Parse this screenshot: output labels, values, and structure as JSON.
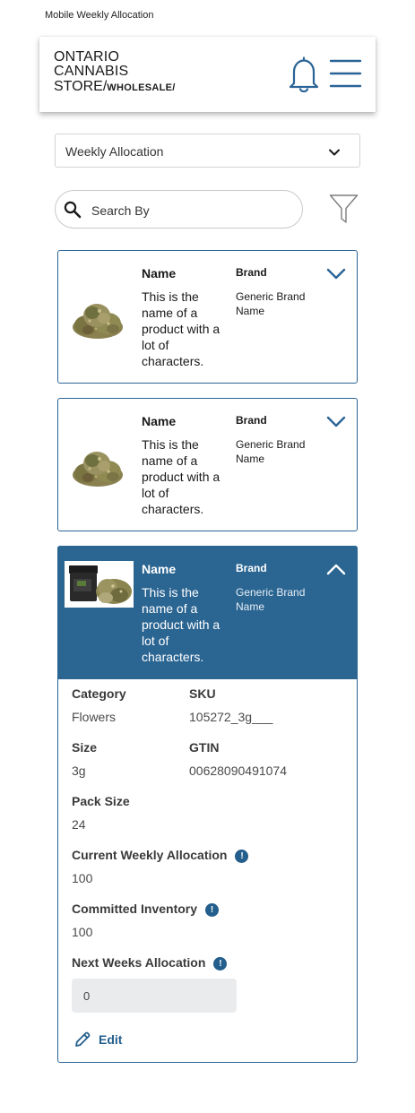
{
  "frame_label": "Mobile Weekly Allocation",
  "header": {
    "logo": {
      "line1": "ONTARIO",
      "line2": "CANNABIS",
      "line3": "STORE",
      "slash": "/",
      "sub": "WHOLESALE/"
    },
    "icons": [
      "bell-icon",
      "hamburger-menu-icon"
    ]
  },
  "dropdown": {
    "selected": "Weekly Allocation",
    "icon": "chevron-down-icon"
  },
  "search": {
    "placeholder": "Search By",
    "icon": "search-icon",
    "filter_icon": "filter-icon"
  },
  "colors": {
    "accent": "#2b6592",
    "border": "#2a6496",
    "input_bg": "#e9ebed",
    "info": "#235e8c"
  },
  "products": [
    {
      "name_label": "Name",
      "name": "This is the name of a product with a lot of characters.",
      "brand_label": "Brand",
      "brand": "Generic Brand Name",
      "expanded": false
    },
    {
      "name_label": "Name",
      "name": "This is the name of a product with a lot of characters.",
      "brand_label": "Brand",
      "brand": "Generic Brand Name",
      "expanded": false
    },
    {
      "name_label": "Name",
      "name": "This is the name of a product with a lot of characters.",
      "brand_label": "Brand",
      "brand": "Generic Brand Name",
      "expanded": true,
      "details": {
        "category_label": "Category",
        "category": "Flowers",
        "sku_label": "SKU",
        "sku": "105272_3g___",
        "size_label": "Size",
        "size": "3g",
        "gtin_label": "GTIN",
        "gtin": "00628090491074",
        "pack_size_label": "Pack Size",
        "pack_size": "24",
        "current_alloc_label": "Current Weekly Allocation",
        "current_alloc": "100",
        "committed_label": "Committed Inventory",
        "committed": "100",
        "next_alloc_label": "Next Weeks Allocation",
        "next_alloc_value": "0",
        "info_glyph": "!",
        "edit_label": "Edit"
      }
    }
  ]
}
